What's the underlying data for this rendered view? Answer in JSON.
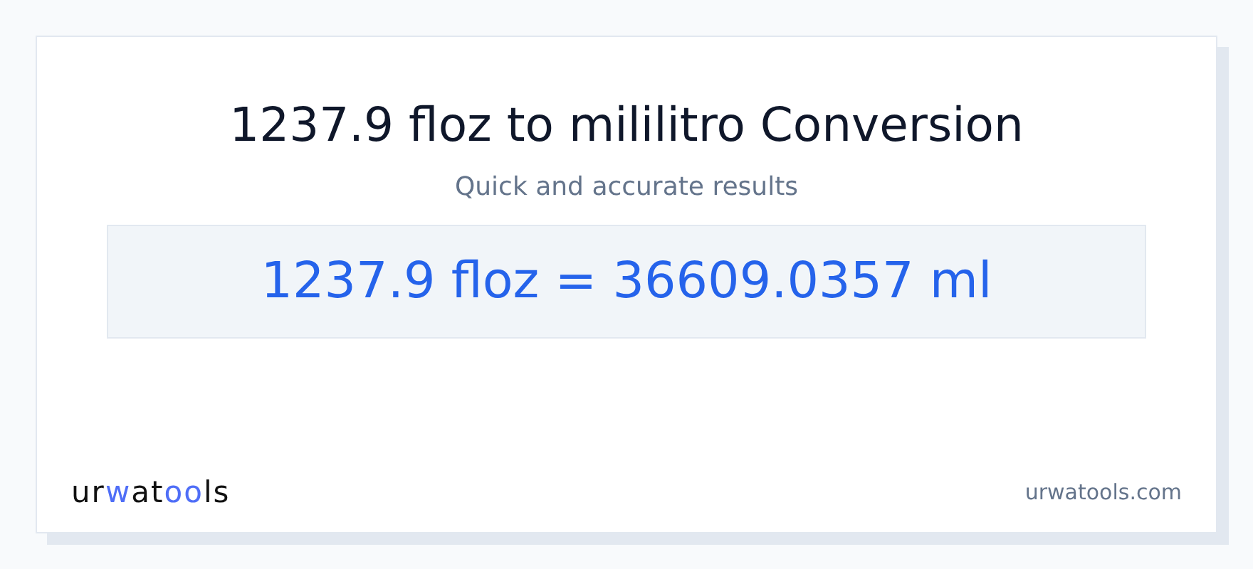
{
  "title": "1237.9 floz to mililitro Conversion",
  "subtitle": "Quick and accurate results",
  "result": "1237.9 floz = 36609.0357 ml",
  "logo": [
    {
      "text": "ur",
      "accent": false
    },
    {
      "text": "w",
      "accent": true
    },
    {
      "text": "at",
      "accent": false
    },
    {
      "text": "oo",
      "accent": true
    },
    {
      "text": "ls",
      "accent": false
    }
  ],
  "site": "urwatools.com"
}
